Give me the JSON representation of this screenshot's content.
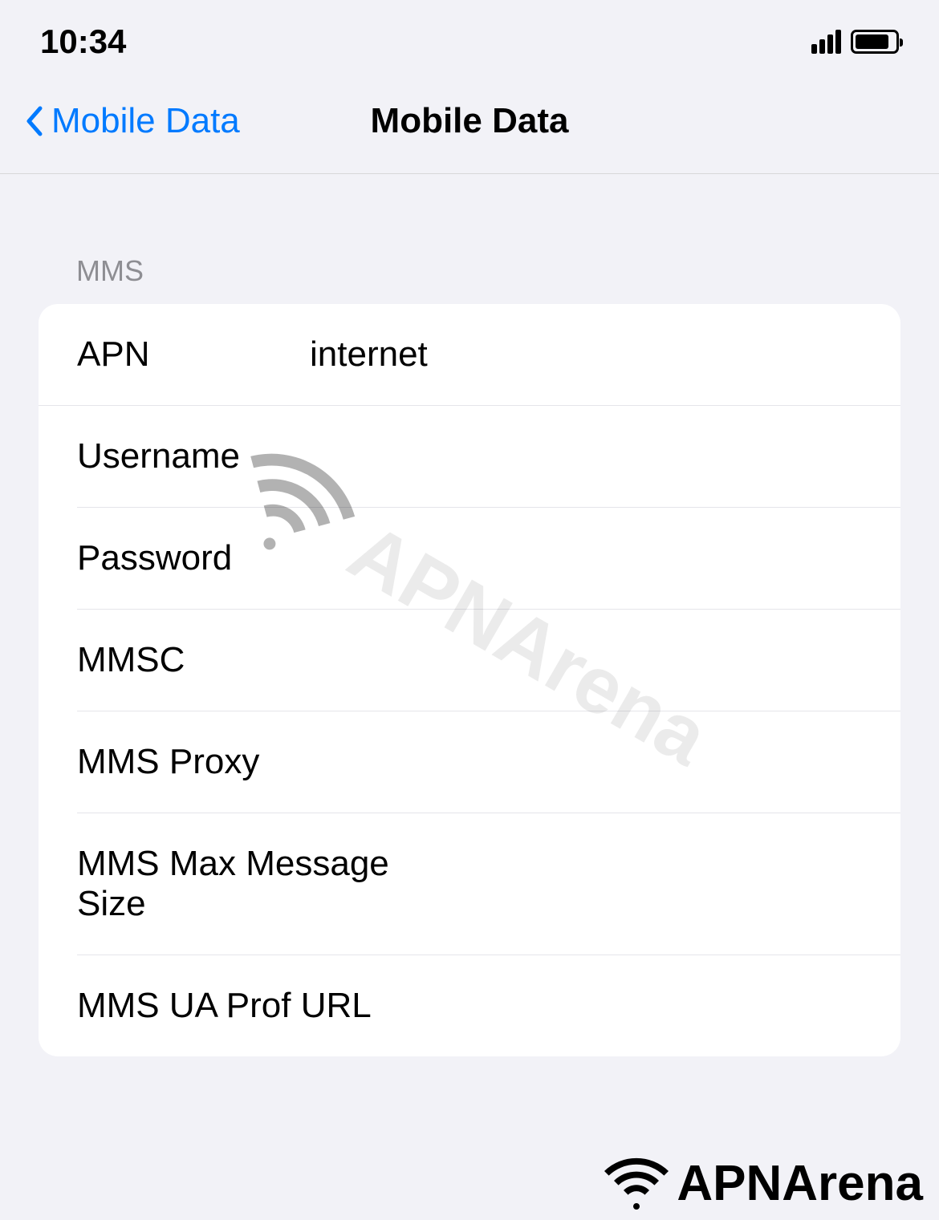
{
  "statusBar": {
    "time": "10:34"
  },
  "navBar": {
    "backLabel": "Mobile Data",
    "title": "Mobile Data"
  },
  "section": {
    "header": "MMS"
  },
  "fields": {
    "apn": {
      "label": "APN",
      "value": "internet"
    },
    "username": {
      "label": "Username",
      "value": ""
    },
    "password": {
      "label": "Password",
      "value": ""
    },
    "mmsc": {
      "label": "MMSC",
      "value": ""
    },
    "mmsProxy": {
      "label": "MMS Proxy",
      "value": ""
    },
    "mmsMaxSize": {
      "label": "MMS Max Message Size",
      "value": ""
    },
    "mmsUaProfUrl": {
      "label": "MMS UA Prof URL",
      "value": ""
    }
  },
  "footer": {
    "brand": "APNArena"
  }
}
